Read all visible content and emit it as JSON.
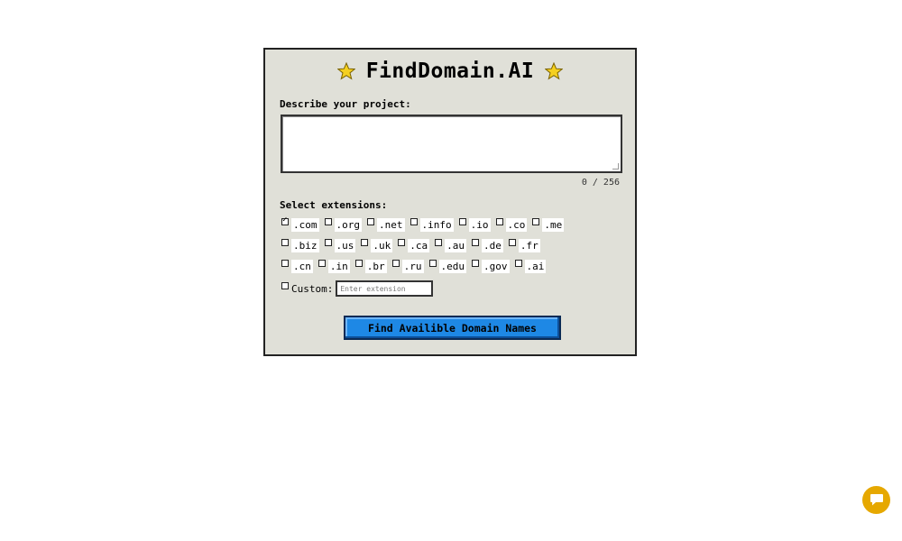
{
  "app": {
    "title": "FindDomain.AI"
  },
  "form": {
    "project_label": "Describe your project:",
    "project_value": "",
    "counter": "0 / 256",
    "extensions_label": "Select extensions:",
    "extension_rows": [
      [
        {
          "label": ".com",
          "checked": true
        },
        {
          "label": ".org",
          "checked": false
        },
        {
          "label": ".net",
          "checked": false
        },
        {
          "label": ".info",
          "checked": false
        },
        {
          "label": ".io",
          "checked": false
        },
        {
          "label": ".co",
          "checked": false
        },
        {
          "label": ".me",
          "checked": false
        }
      ],
      [
        {
          "label": ".biz",
          "checked": false
        },
        {
          "label": ".us",
          "checked": false
        },
        {
          "label": ".uk",
          "checked": false
        },
        {
          "label": ".ca",
          "checked": false
        },
        {
          "label": ".au",
          "checked": false
        },
        {
          "label": ".de",
          "checked": false
        },
        {
          "label": ".fr",
          "checked": false
        }
      ],
      [
        {
          "label": ".cn",
          "checked": false
        },
        {
          "label": ".in",
          "checked": false
        },
        {
          "label": ".br",
          "checked": false
        },
        {
          "label": ".ru",
          "checked": false
        },
        {
          "label": ".edu",
          "checked": false
        },
        {
          "label": ".gov",
          "checked": false
        },
        {
          "label": ".ai",
          "checked": false
        }
      ]
    ],
    "custom_label": "Custom:",
    "custom_placeholder": "Enter extension",
    "custom_checked": false,
    "submit_label": "Find Availible Domain Names"
  },
  "colors": {
    "card_bg": "#e0e0d8",
    "button_blue": "#1e88e5",
    "star": "#f5d020",
    "chat_bubble": "#e6a800"
  },
  "icons": {
    "title_left": "star-icon",
    "title_right": "star-icon",
    "chat": "chat-bubble-icon"
  }
}
